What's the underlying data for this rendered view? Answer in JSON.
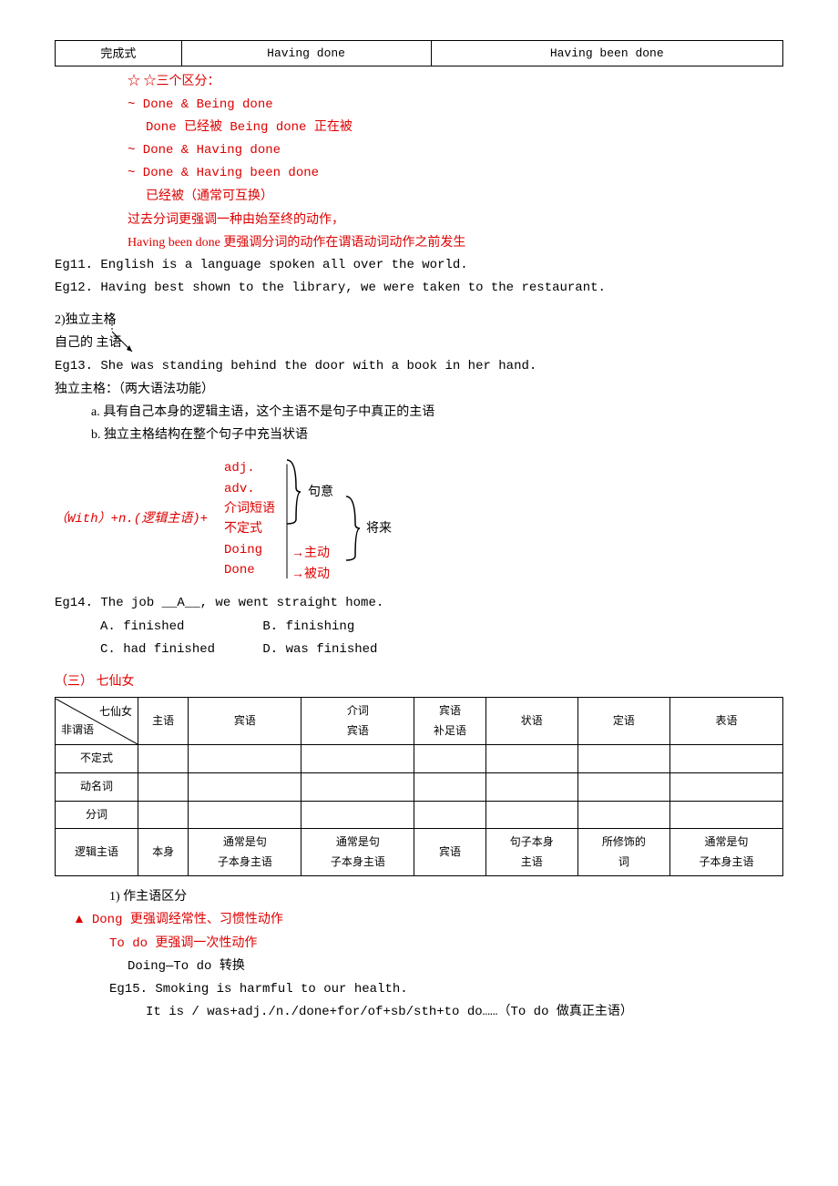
{
  "headerTable": {
    "c1": "完成式",
    "c2": "Having done",
    "c3": "Having been done"
  },
  "distinctions": {
    "title": "☆三个区分：",
    "d1a": "~ Done & Being done",
    "d1b": "Done 已经被    Being done 正在被",
    "d2": "~ Done & Having done",
    "d3a": "~ Done & Having been done",
    "d3b": "已经被（通常可互换）",
    "note1": "过去分词更强调一种由始至终的动作，",
    "note2": "Having been done 更强调分词的动作在谓语动词动作之前发生"
  },
  "eg11": "Eg11. English is a language spoken all over the world.",
  "eg12": "Eg12. Having best shown to the library, we were taken to the restaurant.",
  "sec2": {
    "title": "2)独立主格",
    "sub": "自己的 主语",
    "eg13": "Eg13. She was standing behind the door with a book in her hand.",
    "def": "独立主格：（两大语法功能）",
    "a": "a. 具有自己本身的逻辑主语，这个主语不是句子中真正的主语",
    "b": "b. 独立主格结构在整个句子中充当状语"
  },
  "struct": {
    "left": "（With）+n.(逻辑主语)+",
    "items": [
      "adj.",
      "adv.",
      "介词短语",
      "不定式",
      "Doing",
      "Done"
    ],
    "right1a": "句意",
    "right1b": "将来",
    "arrow1": "→主动",
    "arrow2": "→被动"
  },
  "eg14": {
    "line": "Eg14. The job __A__, we went straight home.",
    "a": "A. finished",
    "b": "B. finishing",
    "c": "C. had finished",
    "d": "D. was finished"
  },
  "sec3title": "（三）    七仙女",
  "qixianTable": {
    "diagTop": "七仙女",
    "diagBot": "非谓语",
    "headers": [
      "主语",
      "宾语",
      "介词宾语",
      "宾语补足语",
      "状语",
      "定语",
      "表语"
    ],
    "rows": [
      "不定式",
      "动名词",
      "分词"
    ],
    "logicRow": {
      "label": "逻辑主语",
      "cells": [
        "本身",
        "通常是句子本身主语",
        "通常是句子本身主语",
        "宾语",
        "句子本身主语",
        "所修饰的词",
        "通常是句子本身主语"
      ]
    }
  },
  "zhuyu": {
    "title": "1) 作主语区分",
    "l1": "Dong 更强调经常性、习惯性动作",
    "l2": "To do 更强调一次性动作",
    "l3": "Doing—To do 转换",
    "eg15": "Eg15. Smoking is harmful to our health.",
    "eg15b": "It is / was+adj./n./done+for/of+sb/sth+to do……（To do 做真正主语）"
  }
}
